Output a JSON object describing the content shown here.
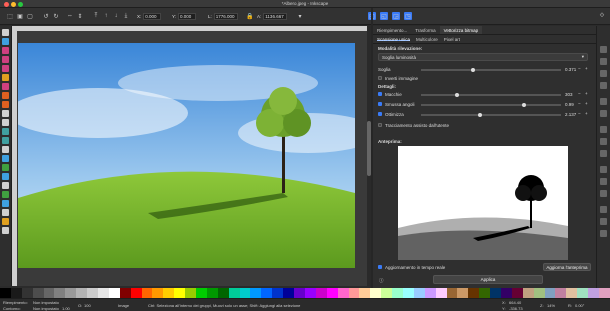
{
  "window": {
    "title": "*Albero.jpeg - Inkscape"
  },
  "toolbar": {
    "x_label": "X:",
    "x_value": "0.000",
    "y_label": "Y:",
    "y_value": "0.000",
    "w_label": "L:",
    "w_value": "1776.000",
    "h_label": "A:",
    "h_value": "1136.667"
  },
  "panel": {
    "tabs": [
      "Riempimento...",
      "Trasforma",
      "Vettorizza bitmap"
    ],
    "active_tab": "Vettorizza bitmap",
    "subtabs": [
      "Scansione unica",
      "Multicolore",
      "Pixel art"
    ],
    "active_subtab": "Scansione unica",
    "detection_mode_label": "Modalità rilevazione:",
    "detection_mode_value": "Soglia luminosità",
    "threshold_label": "Soglia",
    "threshold_value": "0.371",
    "invert_label": "Inverti immagine",
    "details_label": "Dettagli:",
    "speckles_label": "Macchie",
    "speckles_value": "303",
    "smooth_label": "Smussa angoli",
    "smooth_value": "0.99",
    "optimize_label": "Ottimizza",
    "optimize_value": "2.137",
    "stack_label": "Tracciamento assisto dall'utente",
    "preview_label": "Anteprima:",
    "live_update_label": "Aggiornamento in tempo reale",
    "update_preview_button": "Aggiorna l'anteprima",
    "apply_button": "Applica",
    "threshold_fraction": 0.37,
    "speckles_fraction": 0.25,
    "smooth_fraction": 0.74,
    "optimize_fraction": 0.42
  },
  "status": {
    "fill_label": "Riempimento:",
    "fill_value": "Non impostato",
    "stroke_label": "Contorno:",
    "stroke_value": "Non impostato",
    "stroke_width": "1.00",
    "opacity_label": "O:",
    "opacity_value": "100",
    "layer_label": "Image",
    "message": "Ctrl: Seleziona all'interno dei gruppi, Muovi solo un asse; Shift: Aggiungi alla selezione",
    "x_label": "X:",
    "x_value": "664.40",
    "y_label": "Y:",
    "y_value": "-336.73",
    "z_label": "Z:",
    "z_value": "14%",
    "r_label": "R:",
    "r_value": "0.00°"
  },
  "colors": {
    "accent": "#3a7bf7",
    "panel_bg": "#2f2f2f",
    "palette": [
      "#000000",
      "#1a1a1a",
      "#333333",
      "#4d4d4d",
      "#666666",
      "#808080",
      "#999999",
      "#b3b3b3",
      "#cccccc",
      "#e6e6e6",
      "#ffffff",
      "#800000",
      "#ff0000",
      "#ff6600",
      "#ff9900",
      "#ffcc00",
      "#ffff00",
      "#99cc00",
      "#00cc00",
      "#009900",
      "#006600",
      "#00cc99",
      "#00cccc",
      "#0099ff",
      "#0066ff",
      "#0033cc",
      "#000099",
      "#6600cc",
      "#9900ff",
      "#cc00cc",
      "#ff00ff",
      "#ff66cc",
      "#ff9999",
      "#ffcc99",
      "#ffffcc",
      "#ccff99",
      "#99ffcc",
      "#99ffff",
      "#99ccff",
      "#cc99ff",
      "#ffccff",
      "#996633",
      "#cc9966",
      "#663300",
      "#336600",
      "#003366",
      "#330066",
      "#660033",
      "#c0a080",
      "#a0c080",
      "#80a0c0",
      "#c080a0",
      "#e0c0a0",
      "#a0e0c0",
      "#c0a0e0",
      "#e0a0c0"
    ]
  }
}
